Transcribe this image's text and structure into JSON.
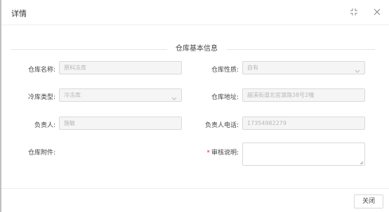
{
  "dialog": {
    "title": "详情",
    "section_title": "仓库基本信息",
    "close_button_label": "关闭"
  },
  "form": {
    "warehouse_name": {
      "label": "仓库名称:",
      "value": "原料冻库"
    },
    "warehouse_nature": {
      "label": "仓库性质:",
      "value": "自有"
    },
    "cold_storage_type": {
      "label": "冷库类型:",
      "value": "冷冻库"
    },
    "warehouse_address": {
      "label": "仓库地址:",
      "value": "越溪街道北官渡路38号2幢"
    },
    "manager": {
      "label": "负责人:",
      "value": "施敏"
    },
    "manager_phone": {
      "label": "负责人电话:",
      "value": "17354982279"
    },
    "attachment": {
      "label": "仓库附件:"
    },
    "review_note": {
      "label": "审核说明:",
      "required_mark": "*",
      "value": ""
    }
  },
  "icons": {
    "fullscreen": "fullscreen-icon",
    "close": "close-icon",
    "dropdown": "chevron-down-icon",
    "resize": "resize-grip-icon"
  },
  "colors": {
    "required": "#f5222d",
    "disabled_bg": "#f5f5f5",
    "border": "#d9d9d9"
  }
}
